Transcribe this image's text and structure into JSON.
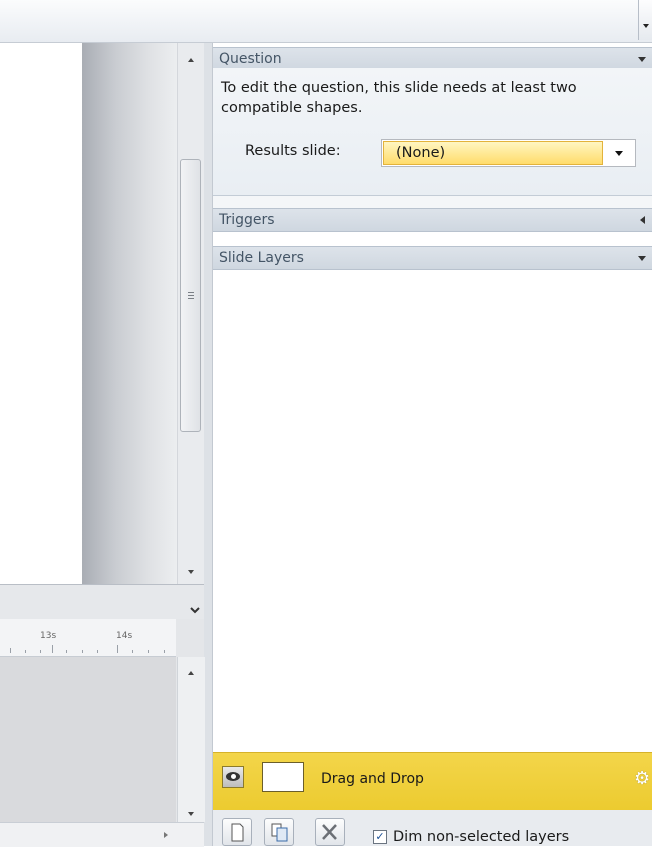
{
  "question": {
    "title": "Question",
    "message": "To edit the question, this slide needs at least two compatible shapes.",
    "results_label": "Results slide:",
    "results_value": "(None)"
  },
  "triggers": {
    "title": "Triggers"
  },
  "slide_layers": {
    "title": "Slide Layers",
    "layers": [
      {
        "name": "Drag and Drop",
        "visible": true
      }
    ],
    "toolbar": {
      "icons": [
        "new-layer-icon",
        "duplicate-layer-icon",
        "delete-layer-icon"
      ],
      "dim_label": "Dim non-selected layers",
      "dim_checked": true
    }
  },
  "timeline": {
    "ruler_labels": [
      "13s",
      "14s"
    ]
  },
  "colors": {
    "selected_layer": "#f0cf3c",
    "section_header": "#d5dce4",
    "results_highlight": "#ffe27a"
  }
}
